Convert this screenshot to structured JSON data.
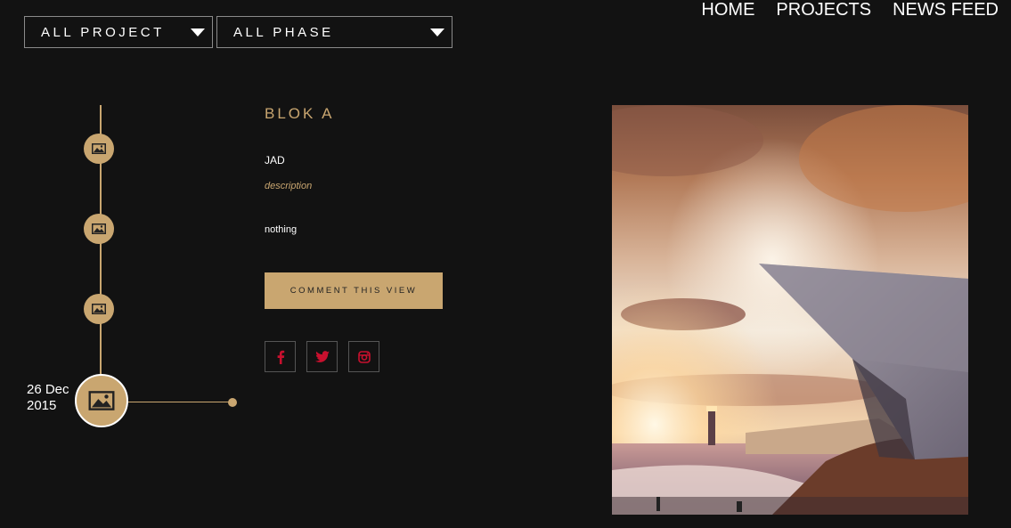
{
  "filters": {
    "project": {
      "selected": "ALL PROJECT"
    },
    "phase": {
      "selected": "ALL PHASE"
    }
  },
  "nav": {
    "home": "HOME",
    "projects": "PROJECTS",
    "news_feed": "NEWS FEED"
  },
  "timeline": {
    "active_date_day": "26 Dec",
    "active_date_year": "2015",
    "items": [
      "image-icon",
      "image-icon",
      "image-icon",
      "image-icon"
    ]
  },
  "post": {
    "title": "BLOK A",
    "author": "JAD",
    "description": "description",
    "body": "nothing",
    "comment_label": "COMMENT THIS VIEW"
  },
  "social": [
    "facebook-icon",
    "twitter-icon",
    "instagram-icon"
  ],
  "colors": {
    "background": "#121212",
    "accent": "#c9a670",
    "social_icon": "#c8102e"
  }
}
